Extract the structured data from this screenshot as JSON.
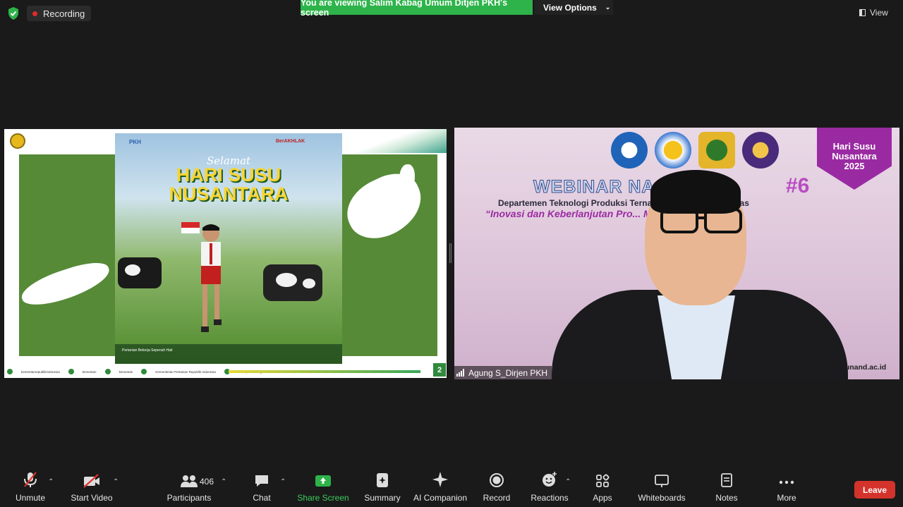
{
  "top": {
    "recording_label": "Recording",
    "viewing_banner": "You are viewing Salim Kabag Umum Ditjen PKH's screen",
    "view_options_label": "View Options",
    "view_label": "View"
  },
  "shared_slide": {
    "poster_brand": "PKH",
    "poster_berakhlak": "BerAKHLAK",
    "poster_greeting": "Selamat",
    "poster_title_line1": "HARI SUSU",
    "poster_title_line2": "NUSANTARA",
    "poster_footer_text": "Pertanian Bekerja Sepenuh Hati",
    "footer_items": [
      "kementanrepublikindonesia",
      "kementan",
      "kementan",
      "Kementerian Pertanian Republik Indonesia",
      "www.pertanian.go.id"
    ],
    "page_number": "2"
  },
  "video": {
    "badge_line1": "Hari Susu",
    "badge_line2": "Nusantara",
    "badge_line3": "2025",
    "webinar_title": "WEBINAR NASIONAL",
    "webinar_number": "#6",
    "department": "Departemen Teknologi Produksi Ternak ... Universitas Andalas",
    "tagline": "“Inovasi dan Keberlanjutan Pro... Mencegah Stunting”",
    "website": "i.unand.ac.id",
    "participant_name": "Agung S_Dirjen PKH"
  },
  "toolbar": {
    "unmute": "Unmute",
    "start_video": "Start Video",
    "participants": "Participants",
    "participants_count": "406",
    "chat": "Chat",
    "share_screen": "Share Screen",
    "summary": "Summary",
    "ai_companion": "AI Companion",
    "record": "Record",
    "reactions": "Reactions",
    "apps": "Apps",
    "whiteboards": "Whiteboards",
    "notes": "Notes",
    "more": "More",
    "leave": "Leave"
  },
  "colors": {
    "share_green": "#2db34a",
    "leave_red": "#d4332b",
    "recording_dot": "#e02b2b"
  }
}
